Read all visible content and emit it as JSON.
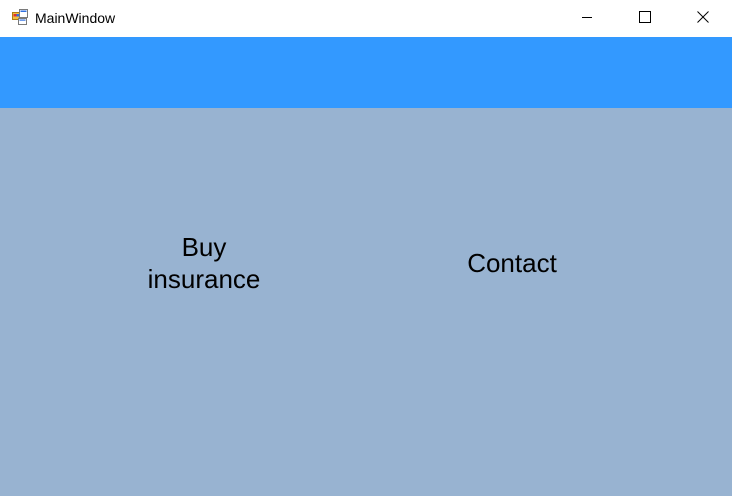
{
  "window": {
    "title": "MainWindow",
    "icon": "app-window-icon",
    "controls": {
      "minimize": "minimize-icon",
      "maximize": "maximize-icon",
      "close": "close-icon"
    }
  },
  "colors": {
    "banner": "#3399ff",
    "content_background": "#98b3d1"
  },
  "menu": {
    "buy_line1": "Buy",
    "buy_line2": "insurance",
    "contact": "Contact"
  }
}
